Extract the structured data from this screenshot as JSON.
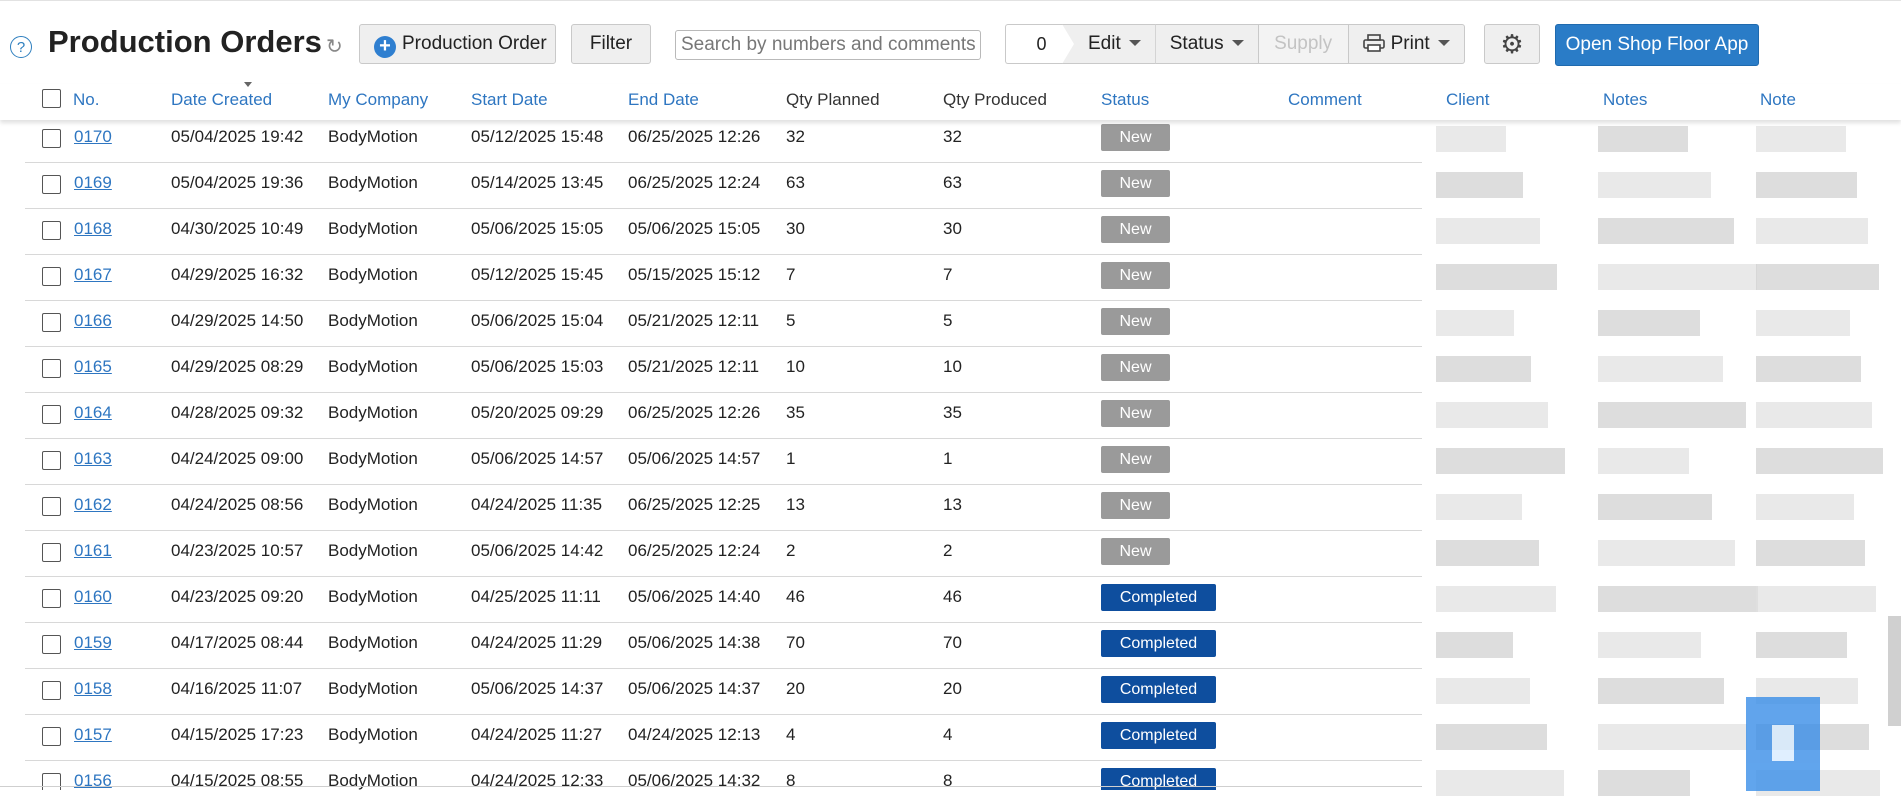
{
  "toolbar": {
    "title": "Production Orders",
    "new_button_label": "Production Order",
    "filter_label": "Filter",
    "search_placeholder": "Search by numbers and comments",
    "selected_count": "0",
    "edit_label": "Edit",
    "status_label": "Status",
    "supply_label": "Supply",
    "print_label": "Print",
    "open_app_label": "Open Shop Floor App"
  },
  "columns": {
    "no": "No.",
    "date_created": "Date Created",
    "my_company": "My Company",
    "start_date": "Start Date",
    "end_date": "End Date",
    "qty_planned": "Qty Planned",
    "qty_produced": "Qty Produced",
    "status": "Status",
    "comment": "Comment",
    "client": "Client",
    "notes": "Notes",
    "note": "Note"
  },
  "rows": [
    {
      "no": "0170",
      "created": "05/04/2025 19:42",
      "company": "BodyMotion",
      "start": "05/12/2025 15:48",
      "end": "06/25/2025 12:26",
      "planned": "32",
      "produced": "32",
      "status": "New"
    },
    {
      "no": "0169",
      "created": "05/04/2025 19:36",
      "company": "BodyMotion",
      "start": "05/14/2025 13:45",
      "end": "06/25/2025 12:24",
      "planned": "63",
      "produced": "63",
      "status": "New"
    },
    {
      "no": "0168",
      "created": "04/30/2025 10:49",
      "company": "BodyMotion",
      "start": "05/06/2025 15:05",
      "end": "05/06/2025 15:05",
      "planned": "30",
      "produced": "30",
      "status": "New"
    },
    {
      "no": "0167",
      "created": "04/29/2025 16:32",
      "company": "BodyMotion",
      "start": "05/12/2025 15:45",
      "end": "05/15/2025 15:12",
      "planned": "7",
      "produced": "7",
      "status": "New"
    },
    {
      "no": "0166",
      "created": "04/29/2025 14:50",
      "company": "BodyMotion",
      "start": "05/06/2025 15:04",
      "end": "05/21/2025 12:11",
      "planned": "5",
      "produced": "5",
      "status": "New"
    },
    {
      "no": "0165",
      "created": "04/29/2025 08:29",
      "company": "BodyMotion",
      "start": "05/06/2025 15:03",
      "end": "05/21/2025 12:11",
      "planned": "10",
      "produced": "10",
      "status": "New"
    },
    {
      "no": "0164",
      "created": "04/28/2025 09:32",
      "company": "BodyMotion",
      "start": "05/20/2025 09:29",
      "end": "06/25/2025 12:26",
      "planned": "35",
      "produced": "35",
      "status": "New"
    },
    {
      "no": "0163",
      "created": "04/24/2025 09:00",
      "company": "BodyMotion",
      "start": "05/06/2025 14:57",
      "end": "05/06/2025 14:57",
      "planned": "1",
      "produced": "1",
      "status": "New"
    },
    {
      "no": "0162",
      "created": "04/24/2025 08:56",
      "company": "BodyMotion",
      "start": "04/24/2025 11:35",
      "end": "06/25/2025 12:25",
      "planned": "13",
      "produced": "13",
      "status": "New"
    },
    {
      "no": "0161",
      "created": "04/23/2025 10:57",
      "company": "BodyMotion",
      "start": "05/06/2025 14:42",
      "end": "06/25/2025 12:24",
      "planned": "2",
      "produced": "2",
      "status": "New"
    },
    {
      "no": "0160",
      "created": "04/23/2025 09:20",
      "company": "BodyMotion",
      "start": "04/25/2025 11:11",
      "end": "05/06/2025 14:40",
      "planned": "46",
      "produced": "46",
      "status": "Completed"
    },
    {
      "no": "0159",
      "created": "04/17/2025 08:44",
      "company": "BodyMotion",
      "start": "04/24/2025 11:29",
      "end": "05/06/2025 14:38",
      "planned": "70",
      "produced": "70",
      "status": "Completed"
    },
    {
      "no": "0158",
      "created": "04/16/2025 11:07",
      "company": "BodyMotion",
      "start": "05/06/2025 14:37",
      "end": "05/06/2025 14:37",
      "planned": "20",
      "produced": "20",
      "status": "Completed"
    },
    {
      "no": "0157",
      "created": "04/15/2025 17:23",
      "company": "BodyMotion",
      "start": "04/24/2025 11:27",
      "end": "04/24/2025 12:13",
      "planned": "4",
      "produced": "4",
      "status": "Completed"
    },
    {
      "no": "0156",
      "created": "04/15/2025 08:55",
      "company": "BodyMotion",
      "start": "04/24/2025 12:33",
      "end": "05/06/2025 14:32",
      "planned": "8",
      "produced": "8",
      "status": "Completed"
    }
  ],
  "icons": {
    "help": "help-icon",
    "refresh": "refresh-icon",
    "add": "plus-circle-icon",
    "print": "printer-icon",
    "settings": "gear-icon",
    "sort": "sort-desc-icon",
    "chat": "chat-widget-icon"
  },
  "colors": {
    "link": "#2e76c1",
    "status_new": "#9a9a9a",
    "status_completed": "#0e4e9e",
    "primary_button": "#2a7cc7"
  }
}
